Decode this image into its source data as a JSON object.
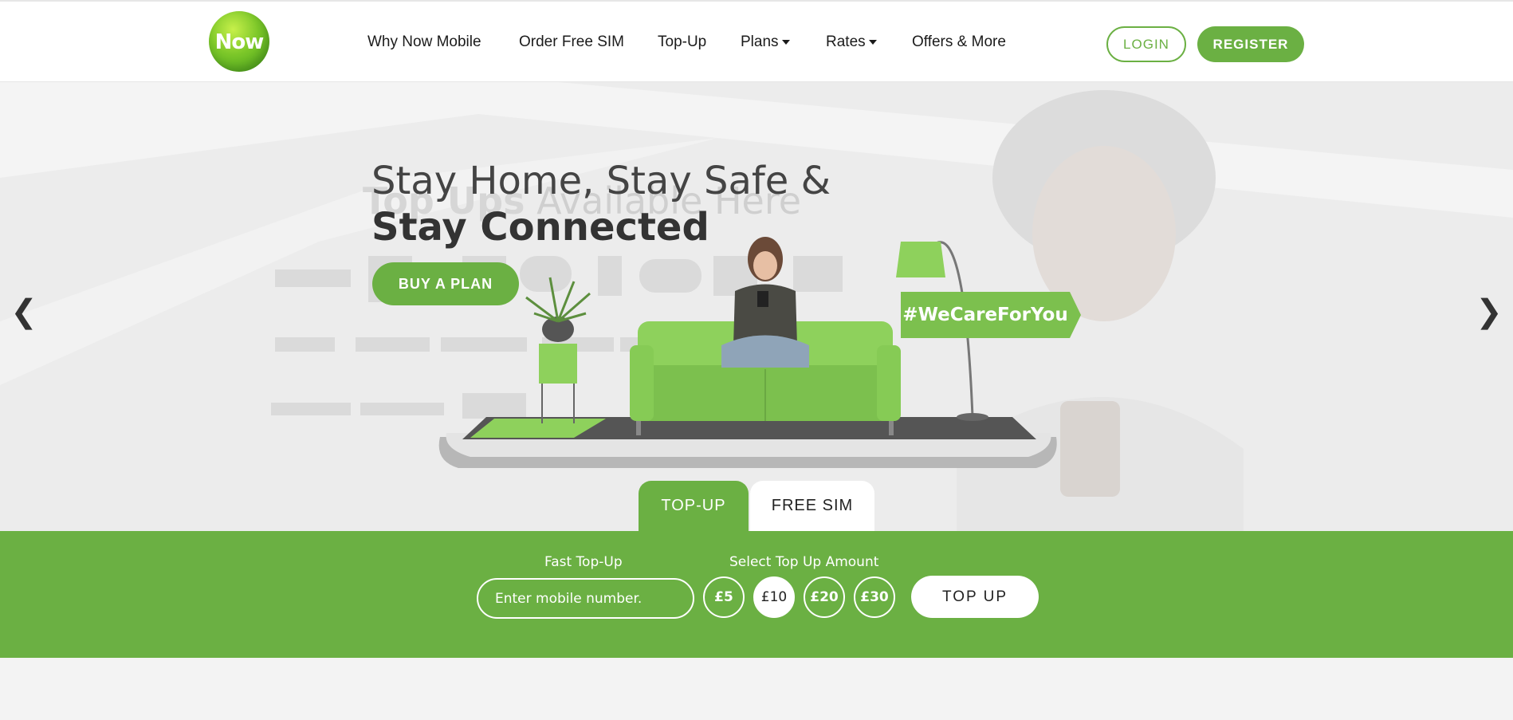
{
  "header": {
    "logo_text": "Now",
    "nav": [
      {
        "label": "Why Now Mobile"
      },
      {
        "label": "Order Free SIM"
      },
      {
        "label": "Top-Up"
      },
      {
        "label": "Plans"
      },
      {
        "label": "Rates"
      },
      {
        "label": "Offers & More"
      }
    ],
    "login_label": "LOGIN",
    "register_label": "REGISTER"
  },
  "hero": {
    "ghost_text_bold": "Top Ups",
    "ghost_text_rest": " Available Here",
    "title_line1": "Stay Home, Stay Safe &",
    "title_line2": "Stay Connected",
    "cta_label": "BUY A PLAN",
    "hashtag": "#WeCareForYou",
    "prev_arrow": "❮",
    "next_arrow": "❯"
  },
  "tabs": [
    {
      "label": "TOP-UP",
      "active": true
    },
    {
      "label": "FREE SIM",
      "active": false
    }
  ],
  "topup": {
    "fast_label": "Fast Top-Up",
    "mobile_placeholder": "Enter mobile number.",
    "amount_label": "Select Top Up Amount",
    "amounts": [
      "£5",
      "£10",
      "£20",
      "£30"
    ],
    "selected_amount": "£10",
    "submit_label": "TOP UP"
  },
  "colors": {
    "brand_green": "#6bb043",
    "text_dark": "#1b1b1b"
  }
}
